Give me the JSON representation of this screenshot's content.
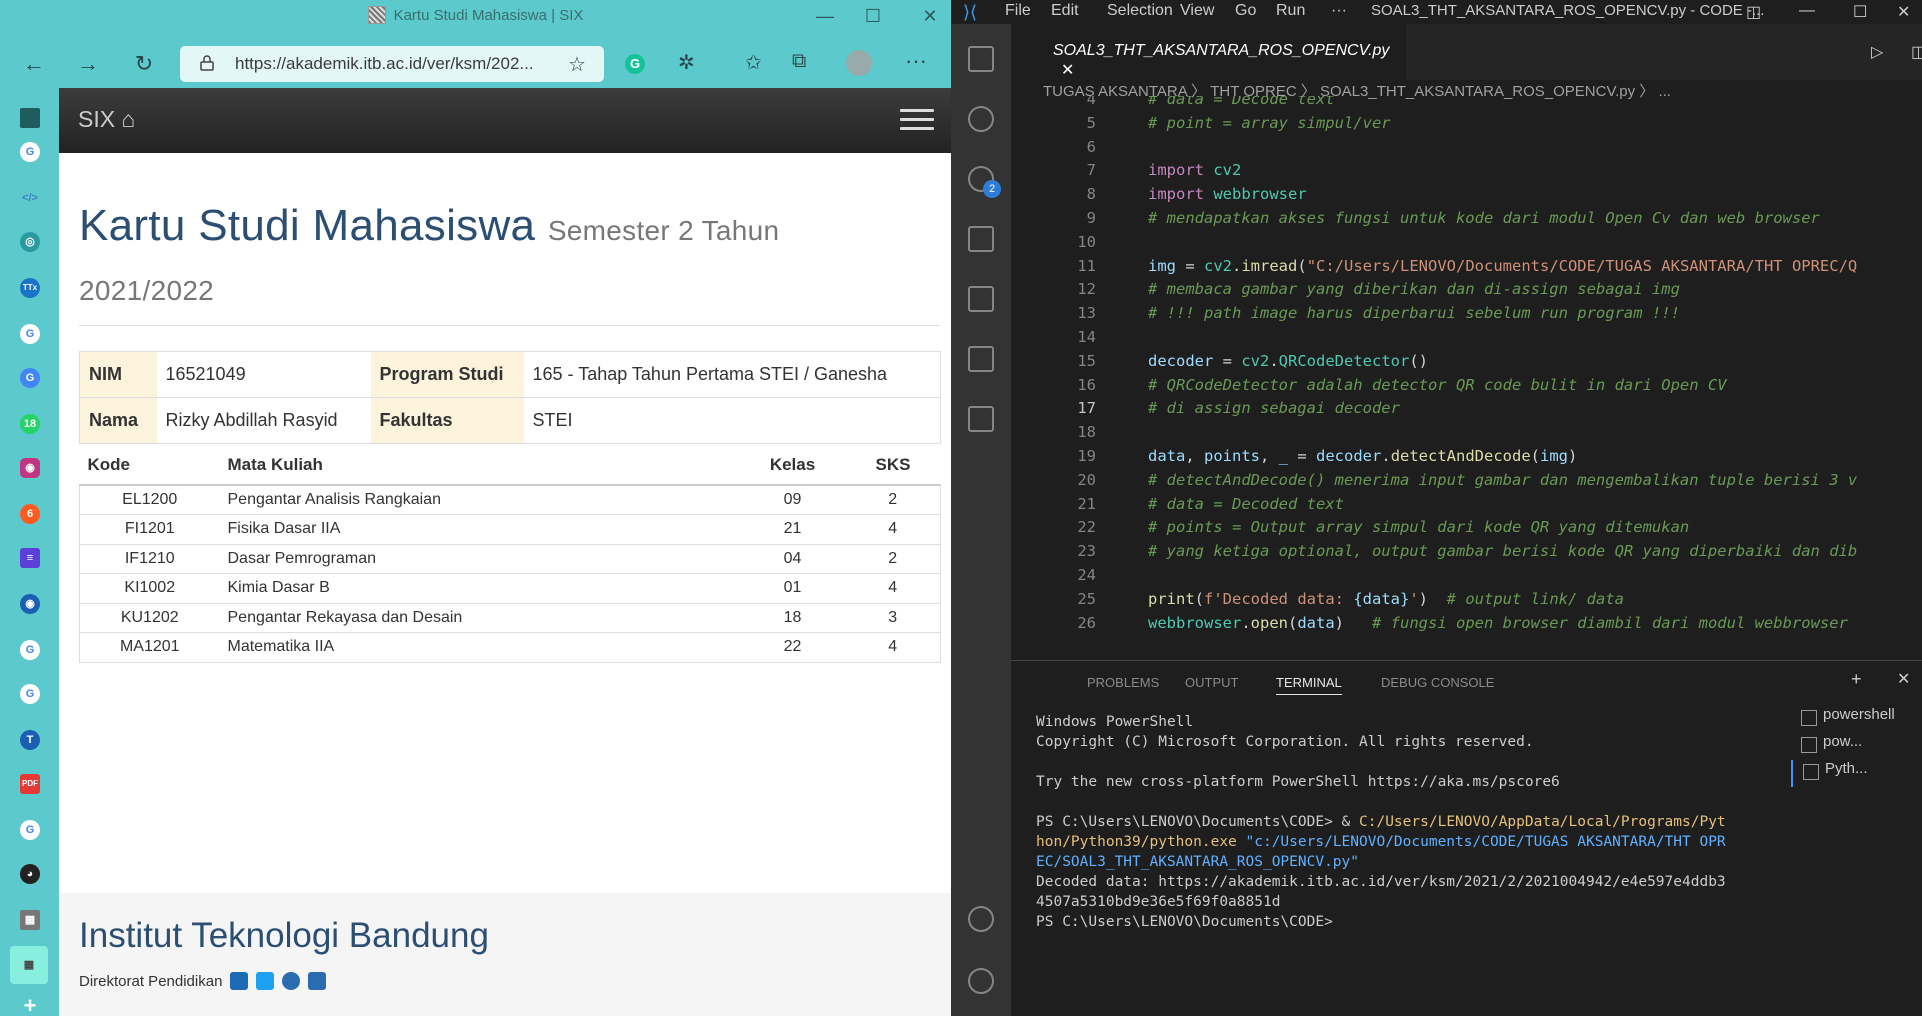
{
  "browser": {
    "tab_title": "Kartu Studi Mahasiswa | SIX",
    "url": "https://akademik.itb.ac.id/ver/ksm/202...",
    "brand": "SIX",
    "heading": "Kartu Studi Mahasiswa",
    "subheading": "Semester 2 Tahun 2021/2022",
    "info": {
      "nim_label": "NIM",
      "nim": "16521049",
      "prodi_label": "Program Studi",
      "prodi": "165 - Tahap Tahun Pertama STEI / Ganesha",
      "nama_label": "Nama",
      "nama": "Rizky Abdillah Rasyid",
      "fakultas_label": "Fakultas",
      "fakultas": "STEI"
    },
    "columns": [
      "Kode",
      "Mata Kuliah",
      "Kelas",
      "SKS"
    ],
    "courses": [
      {
        "kode": "EL1200",
        "mk": "Pengantar Analisis Rangkaian",
        "kelas": "09",
        "sks": "2"
      },
      {
        "kode": "FI1201",
        "mk": "Fisika Dasar IIA",
        "kelas": "21",
        "sks": "4"
      },
      {
        "kode": "IF1210",
        "mk": "Dasar Pemrograman",
        "kelas": "04",
        "sks": "2"
      },
      {
        "kode": "KI1002",
        "mk": "Kimia Dasar B",
        "kelas": "01",
        "sks": "4"
      },
      {
        "kode": "KU1202",
        "mk": "Pengantar Rekayasa dan Desain",
        "kelas": "18",
        "sks": "3"
      },
      {
        "kode": "MA1201",
        "mk": "Matematika IIA",
        "kelas": "22",
        "sks": "4"
      }
    ],
    "footer_title": "Institut Teknologi Bandung",
    "footer_sub": "Direktorat Pendidikan"
  },
  "vscode": {
    "menu": [
      "File",
      "Edit",
      "Selection",
      "View",
      "Go",
      "Run",
      "···"
    ],
    "window_title": "SOAL3_THT_AKSANTARA_ROS_OPENCV.py - CODE -...",
    "tab": "SOAL3_THT_AKSANTARA_ROS_OPENCV.py",
    "breadcrumb": "TUGAS AKSANTARA  〉 THT OPREC  〉 SOAL3_THT_AKSANTARA_ROS_OPENCV.py 〉 ...",
    "scm_badge": "2",
    "panel_tabs": [
      "PROBLEMS",
      "OUTPUT",
      "TERMINAL",
      "DEBUG CONSOLE"
    ],
    "terminals": [
      "powershell",
      "pow...",
      "Pyth..."
    ],
    "terminal_lines": [
      "Windows PowerShell",
      "Copyright (C) Microsoft Corporation. All rights reserved.",
      "",
      "Try the new cross-platform PowerShell https://aka.ms/pscore6",
      "",
      "PS C:\\Users\\LENOVO\\Documents\\CODE> & ",
      "hon/Python39/python.exe ",
      "EC/SOAL3_THT_AKSANTARA_ROS_OPENCV.py\"",
      "Decoded data: https://akademik.itb.ac.id/ver/ksm/2021/2/2021004942/e4e597e4ddb3",
      "4507a5310bd9e36e5f69f0a8851d",
      "PS C:\\Users\\LENOVO\\Documents\\CODE>"
    ],
    "terminal_path1": "C:/Users/LENOVO/AppData/Local/Programs/Pyt",
    "terminal_path2": "\"c:/Users/LENOVO/Documents/CODE/TUGAS AKSANTARA/THT OPR",
    "code_lines": [
      {
        "n": "4",
        "html": "<span class='cm'># data = Decode text</span>"
      },
      {
        "n": "5",
        "html": "<span class='cm'># point = array simpul/ver</span>"
      },
      {
        "n": "6",
        "html": ""
      },
      {
        "n": "7",
        "html": "<span class='kw'>import</span> <span class='ty'>cv2</span>"
      },
      {
        "n": "8",
        "html": "<span class='kw'>import</span> <span class='ty'>webbrowser</span>"
      },
      {
        "n": "9",
        "html": "<span class='cm'># mendapatkan akses fungsi untuk kode dari modul Open Cv dan web browser</span>"
      },
      {
        "n": "10",
        "html": ""
      },
      {
        "n": "11",
        "html": "<span class='vr'>img</span> = <span class='ty'>cv2</span>.<span class='fn'>imread</span>(<span class='str'>\"C:/Users/LENOVO/Documents/CODE/TUGAS AKSANTARA/THT OPREC/Q</span>"
      },
      {
        "n": "12",
        "html": "<span class='cm'># membaca gambar yang diberikan dan di-assign sebagai img</span>"
      },
      {
        "n": "13",
        "html": "<span class='cm'># !!! path image harus diperbarui sebelum run program !!!</span>"
      },
      {
        "n": "14",
        "html": ""
      },
      {
        "n": "15",
        "html": "<span class='vr'>decoder</span> = <span class='ty'>cv2</span>.<span class='ty'>QRCodeDetector</span>()"
      },
      {
        "n": "16",
        "html": "<span class='cm'># QRCodeDetector adalah detector QR code bulit in dari Open CV</span>"
      },
      {
        "n": "17",
        "html": "<span class='cm'># di assign sebagai decoder</span>"
      },
      {
        "n": "18",
        "html": ""
      },
      {
        "n": "19",
        "html": "<span class='vr'>data</span>, <span class='vr'>points</span>, <span class='vr'>_</span> = <span class='vr'>decoder</span>.<span class='fn'>detectAndDecode</span>(<span class='vr'>img</span>)"
      },
      {
        "n": "20",
        "html": "<span class='cm'># detectAndDecode() menerima input gambar dan mengembalikan tuple berisi 3 v</span>"
      },
      {
        "n": "21",
        "html": "<span class='cm'># data = Decoded text</span>"
      },
      {
        "n": "22",
        "html": "<span class='cm'># points = Output array simpul dari kode QR yang ditemukan</span>"
      },
      {
        "n": "23",
        "html": "<span class='cm'># yang ketiga optional, output gambar berisi kode QR yang diperbaiki dan dib</span>"
      },
      {
        "n": "24",
        "html": ""
      },
      {
        "n": "25",
        "html": "<span class='fn'>print</span>(<span class='str'>f'Decoded data: </span><span class='vr'>{data}</span><span class='str'>'</span>)  <span class='cm'># output link/ data</span>"
      },
      {
        "n": "26",
        "html": "<span class='ty'>webbrowser</span>.<span class='fn'>open</span>(<span class='vr'>data</span>)   <span class='cm'># fungsi open browser diambil dari modul webbrowser</span>"
      }
    ]
  }
}
